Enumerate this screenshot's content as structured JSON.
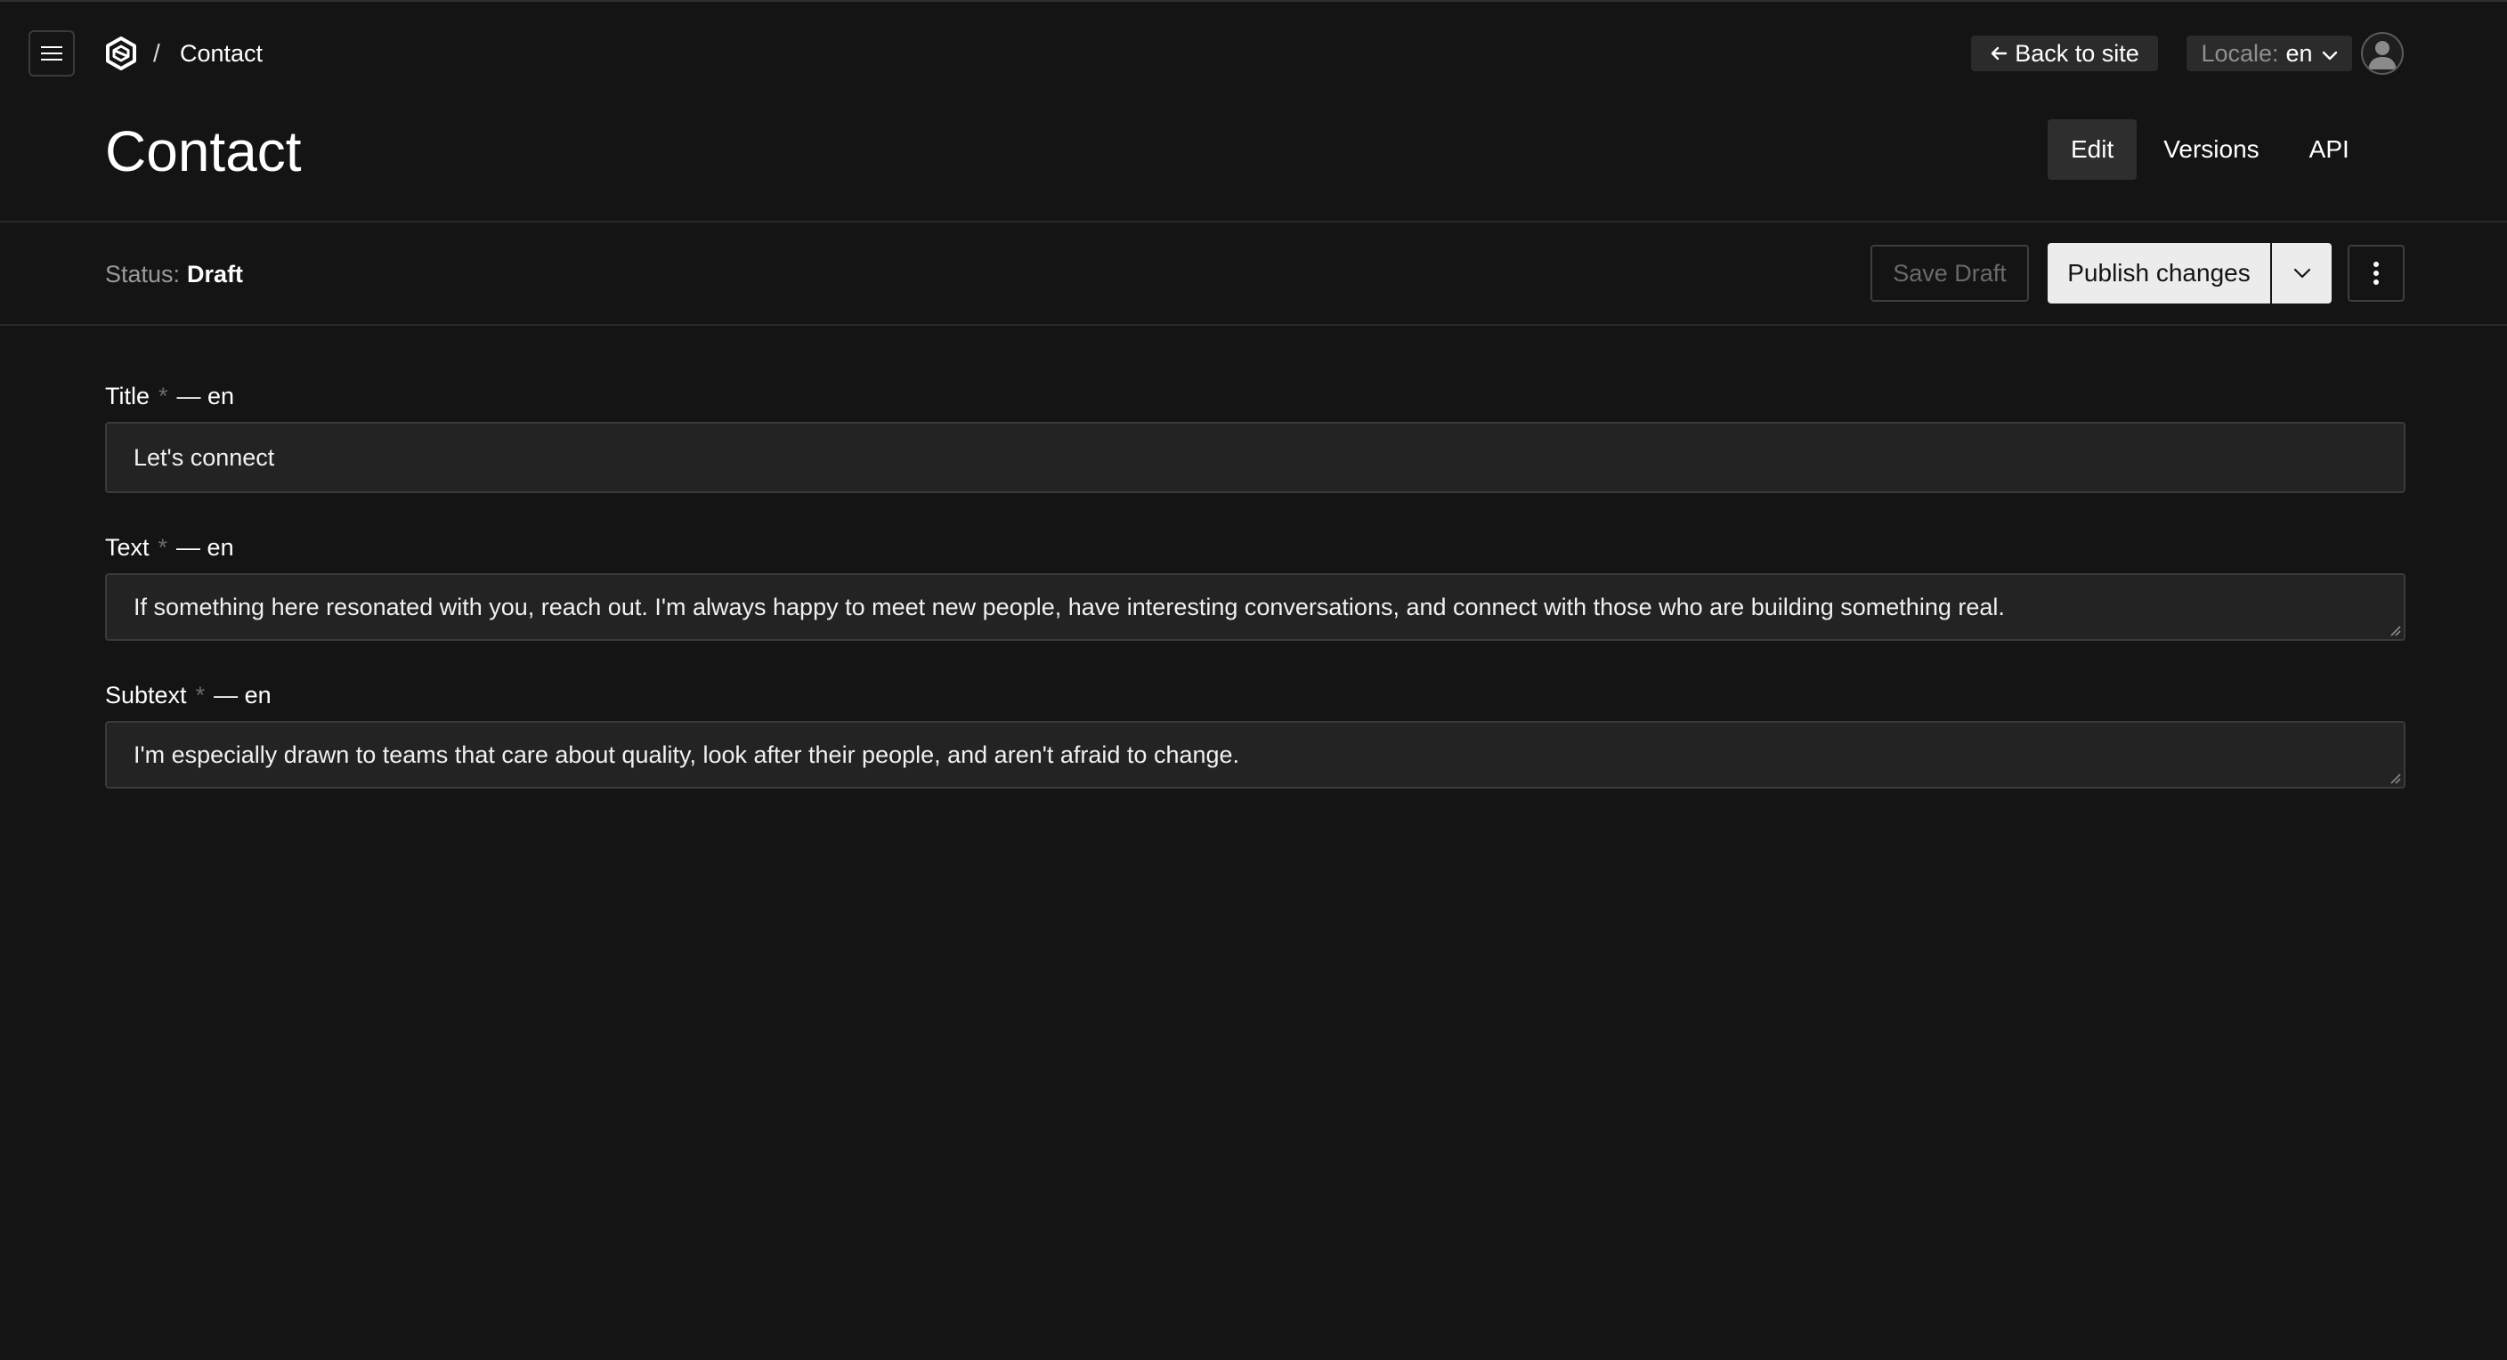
{
  "breadcrumb": {
    "separator": "/",
    "current": "Contact"
  },
  "header": {
    "back_label": "Back to site",
    "locale_label": "Locale:",
    "locale_value": "en",
    "title": "Contact",
    "tabs": [
      {
        "label": "Edit",
        "active": true
      },
      {
        "label": "Versions",
        "active": false
      },
      {
        "label": "API",
        "active": false
      }
    ]
  },
  "statusbar": {
    "status_label": "Status:",
    "status_value": "Draft",
    "save_draft_label": "Save Draft",
    "publish_label": "Publish changes"
  },
  "form": {
    "fields": [
      {
        "label": "Title",
        "required_mark": "*",
        "locale": "— en",
        "value": "Let's connect"
      },
      {
        "label": "Text",
        "required_mark": "*",
        "locale": "— en",
        "value": "If something here resonated with you, reach out. I'm always happy to meet new people, have interesting conversations, and connect with those who are building something real."
      },
      {
        "label": "Subtext",
        "required_mark": "*",
        "locale": "— en",
        "value": "I'm especially drawn to teams that care about quality, look after their people, and aren't afraid to change."
      }
    ]
  },
  "icons": {
    "menu": "hamburger-icon",
    "logo": "hexagon-logo",
    "back": "arrow-left-icon",
    "locale": "chevron-down-icon",
    "avatar": "user-icon",
    "publish_options": "chevron-down-icon",
    "more": "more-vertical-icon"
  },
  "colors": {
    "background": "#141414",
    "surface": "#232323",
    "border": "#3a3a3a",
    "publish_bg": "#ececec",
    "muted_text": "#9a9a9a"
  }
}
